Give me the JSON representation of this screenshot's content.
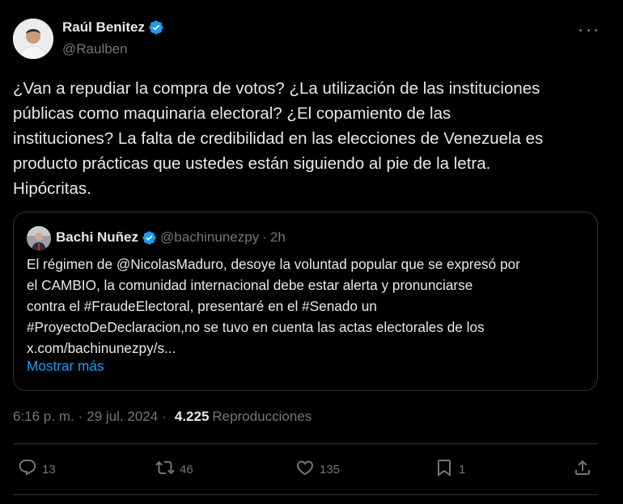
{
  "author": {
    "name": "Raúl Benitez",
    "handle": "@Raulben"
  },
  "tweet_text": "¿Van a repudiar la compra de votos? ¿La utilización de las instituciones\npúblicas como maquinaria electoral? ¿El copamiento de las\ninstituciones? La falta de credibilidad en las elecciones de Venezuela es\nproducto prácticas que ustedes están siguiendo al pie de la letra.\nHipócritas.",
  "quoted": {
    "name": "Bachi Nuñez",
    "handle": "@bachinunezpy",
    "separator": "·",
    "time": "2h",
    "text": "El régimen de @NicolasMaduro, desoye la voluntad popular que se expresó por\nel CAMBIO, la comunidad internacional debe estar alerta y pronunciarse\ncontra el #FraudeElectoral, presentaré  en el #Senado un\n#ProyectoDeDeclaracion,no se tuvo en cuenta las actas electorales de los\nx.com/bachinunezpy/s...",
    "show_more": "Mostrar más"
  },
  "meta": {
    "time": "6:16 p. m.",
    "separator": "·",
    "date": "29 jul. 2024",
    "separator2": "·",
    "views": "4.225",
    "views_label": "Reproducciones"
  },
  "actions": {
    "replies": "13",
    "reposts": "46",
    "likes": "135",
    "bookmarks": "1"
  },
  "colors": {
    "background": "#000000",
    "text": "#e7e9ea",
    "secondary": "#71767b",
    "link": "#1d9bf0",
    "verified": "#1d9bf0",
    "border": "#2f3336"
  },
  "icons": {
    "verified": "verified-badge-icon",
    "more": "more-horizontal-icon",
    "reply": "reply-icon",
    "repost": "repost-icon",
    "like": "like-icon",
    "bookmark": "bookmark-icon",
    "share": "share-icon"
  }
}
